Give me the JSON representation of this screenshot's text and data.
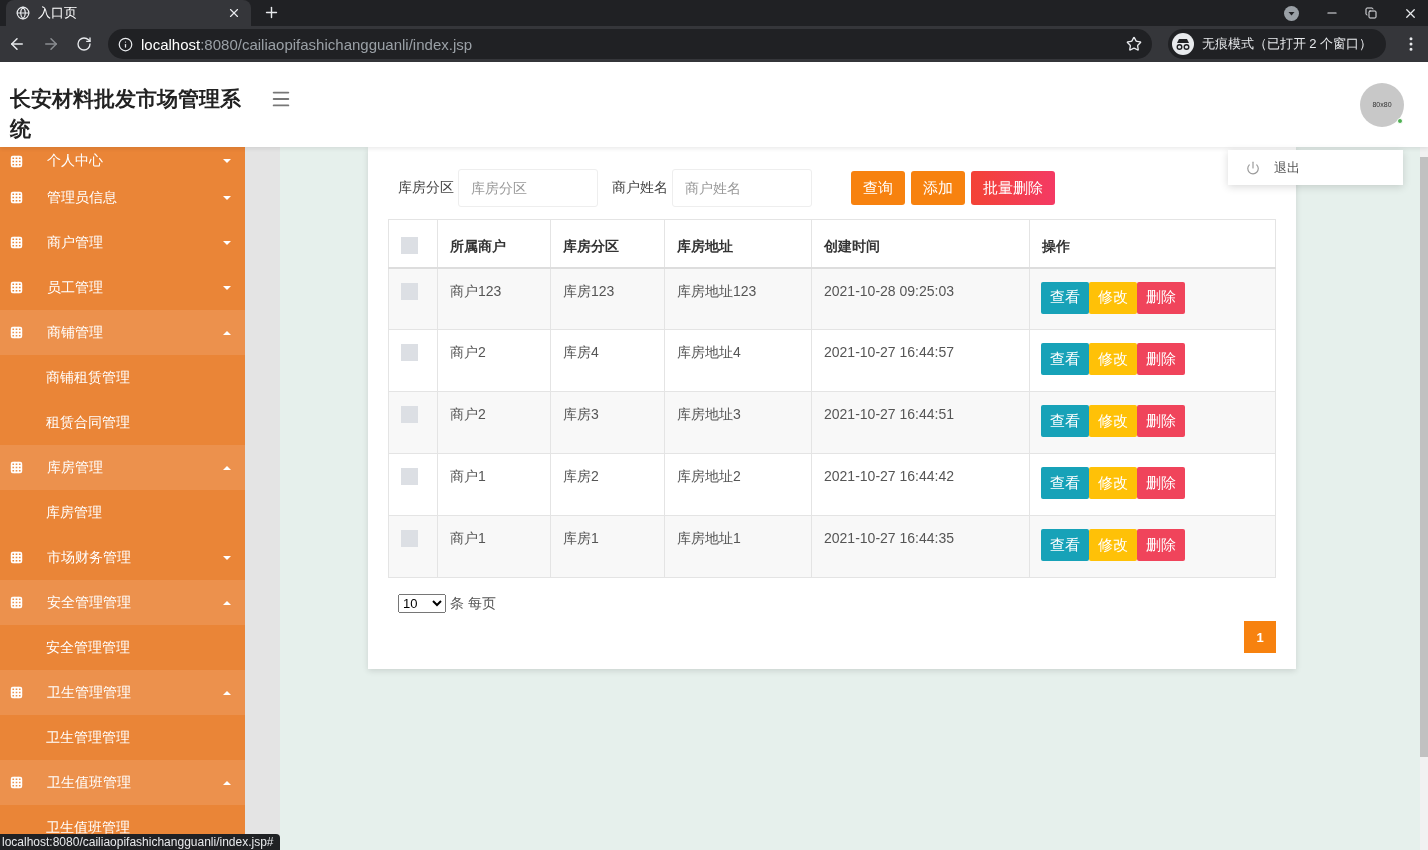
{
  "browser": {
    "tab_title": "入口页",
    "url_host": "localhost",
    "url_rest": ":8080/cailiaopifashichangguanli/index.jsp",
    "incognito": "无痕模式（已打开 2 个窗口）",
    "status_url": "localhost:8080/cailiaopifashichangguanli/index.jsp#"
  },
  "header": {
    "title": "长安材料批发市场管理系统",
    "avatar": "80x80",
    "menu": [
      {
        "label": "退出"
      }
    ]
  },
  "sidebar": {
    "items": [
      {
        "label": "个人中心",
        "expanded": false
      },
      {
        "label": "管理员信息",
        "expanded": false
      },
      {
        "label": "商户管理",
        "expanded": false
      },
      {
        "label": "员工管理",
        "expanded": false
      },
      {
        "label": "商铺管理",
        "expanded": true,
        "children": [
          {
            "label": "商铺租赁管理"
          },
          {
            "label": "租赁合同管理"
          }
        ]
      },
      {
        "label": "库房管理",
        "expanded": true,
        "children": [
          {
            "label": "库房管理"
          }
        ]
      },
      {
        "label": "市场财务管理",
        "expanded": false
      },
      {
        "label": "安全管理管理",
        "expanded": true,
        "children": [
          {
            "label": "安全管理管理"
          }
        ]
      },
      {
        "label": "卫生管理管理",
        "expanded": true,
        "children": [
          {
            "label": "卫生管理管理"
          }
        ]
      },
      {
        "label": "卫生值班管理",
        "expanded": true,
        "children": [
          {
            "label": "卫生值班管理"
          }
        ]
      }
    ]
  },
  "search": {
    "fields": [
      {
        "label": "库房分区",
        "placeholder": "库房分区"
      },
      {
        "label": "商户姓名",
        "placeholder": "商户姓名"
      }
    ],
    "buttons": [
      {
        "label": "查询",
        "kind": "primary"
      },
      {
        "label": "添加",
        "kind": "primary"
      },
      {
        "label": "批量删除",
        "kind": "danger"
      }
    ]
  },
  "table": {
    "select_all": {
      "checked": false
    },
    "columns": [
      "所属商户",
      "库房分区",
      "库房地址",
      "创建时间",
      "操作"
    ],
    "rows": [
      {
        "checked": false,
        "cells": [
          "商户123",
          "库房123",
          "库房地址123",
          "2021-10-28 09:25:03"
        ],
        "actions": [
          {
            "label": "查看",
            "kind": "view"
          },
          {
            "label": "修改",
            "kind": "edit"
          },
          {
            "label": "删除",
            "kind": "delete"
          }
        ]
      },
      {
        "checked": false,
        "cells": [
          "商户2",
          "库房4",
          "库房地址4",
          "2021-10-27 16:44:57"
        ],
        "actions": [
          {
            "label": "查看",
            "kind": "view"
          },
          {
            "label": "修改",
            "kind": "edit"
          },
          {
            "label": "删除",
            "kind": "delete"
          }
        ]
      },
      {
        "checked": false,
        "cells": [
          "商户2",
          "库房3",
          "库房地址3",
          "2021-10-27 16:44:51"
        ],
        "actions": [
          {
            "label": "查看",
            "kind": "view"
          },
          {
            "label": "修改",
            "kind": "edit"
          },
          {
            "label": "删除",
            "kind": "delete"
          }
        ]
      },
      {
        "checked": false,
        "cells": [
          "商户1",
          "库房2",
          "库房地址2",
          "2021-10-27 16:44:42"
        ],
        "actions": [
          {
            "label": "查看",
            "kind": "view"
          },
          {
            "label": "修改",
            "kind": "edit"
          },
          {
            "label": "删除",
            "kind": "delete"
          }
        ]
      },
      {
        "checked": false,
        "cells": [
          "商户1",
          "库房1",
          "库房地址1",
          "2021-10-27 16:44:35"
        ],
        "actions": [
          {
            "label": "查看",
            "kind": "view"
          },
          {
            "label": "修改",
            "kind": "edit"
          },
          {
            "label": "删除",
            "kind": "delete"
          }
        ]
      }
    ]
  },
  "pagination": {
    "page_size": "10",
    "page_size_label": "条 每页",
    "pages": [
      {
        "label": "1",
        "selected": true
      }
    ]
  }
}
